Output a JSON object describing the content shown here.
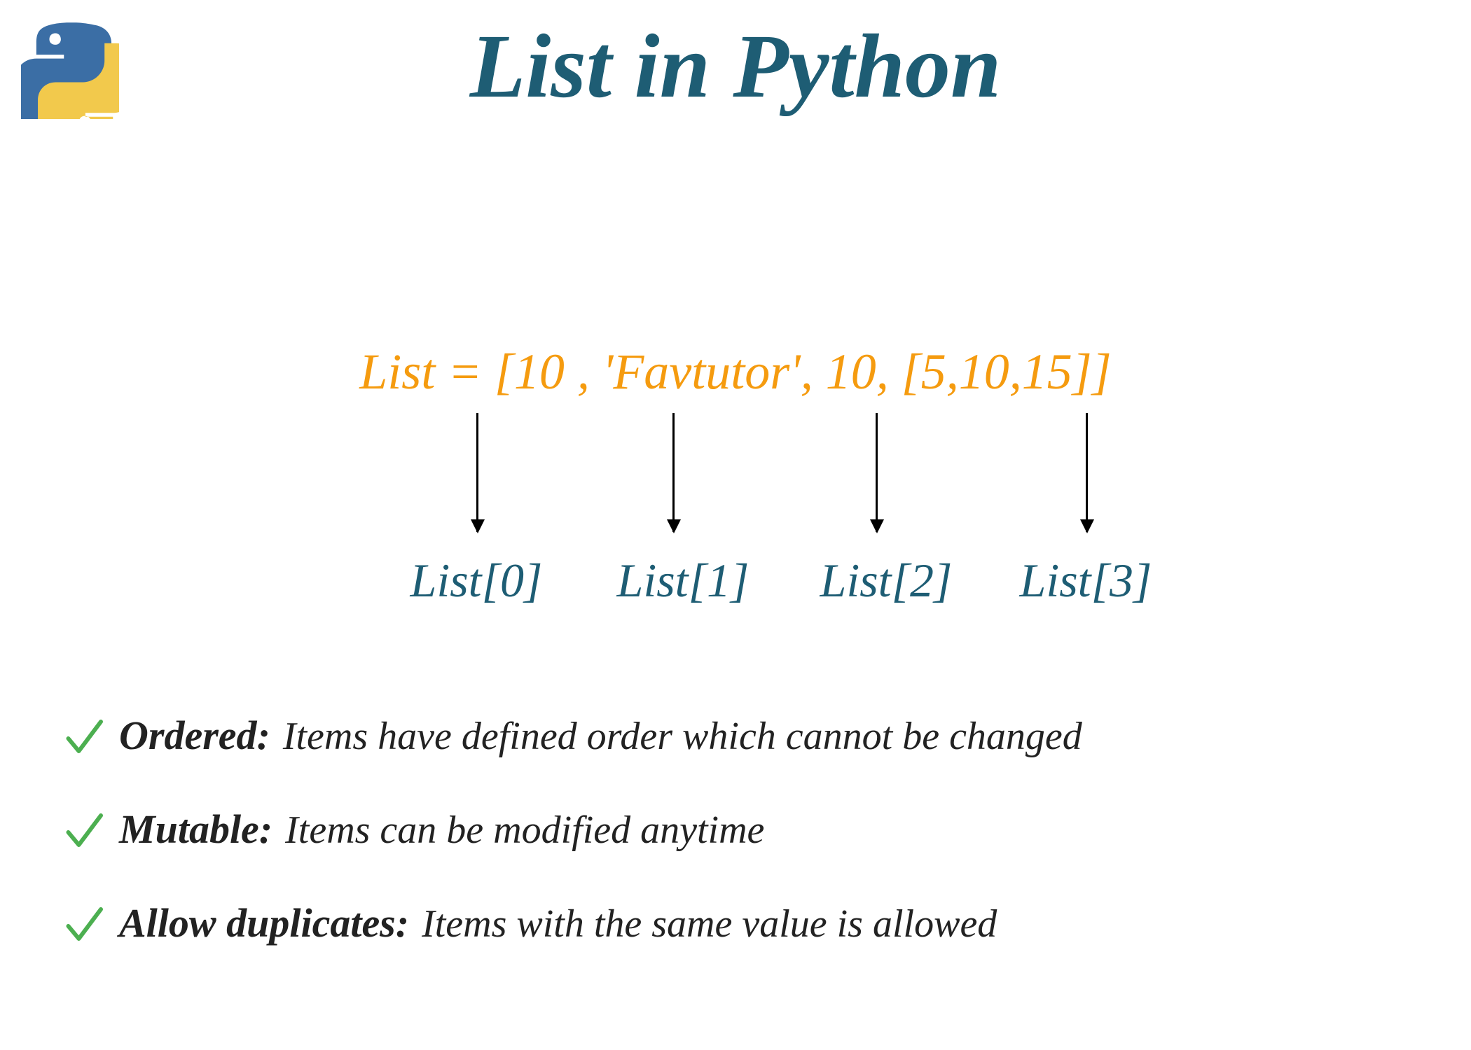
{
  "title": "List in Python",
  "list_declaration": "List = [10 , 'Favtutor', 10, [5,10,15]]",
  "indices": [
    "List[0]",
    "List[1]",
    "List[2]",
    "List[3]"
  ],
  "features": [
    {
      "label": "Ordered:",
      "desc": "Items have defined order which cannot be changed"
    },
    {
      "label": "Mutable:",
      "desc": "Items can be modified anytime"
    },
    {
      "label": "Allow duplicates:",
      "desc": "Items with the same value is  allowed"
    }
  ],
  "colors": {
    "title": "#1e5d74",
    "accent_orange": "#f59b0f",
    "check_green": "#4caf50",
    "logo_blue": "#3b6ea5",
    "logo_yellow": "#f2c94c"
  }
}
